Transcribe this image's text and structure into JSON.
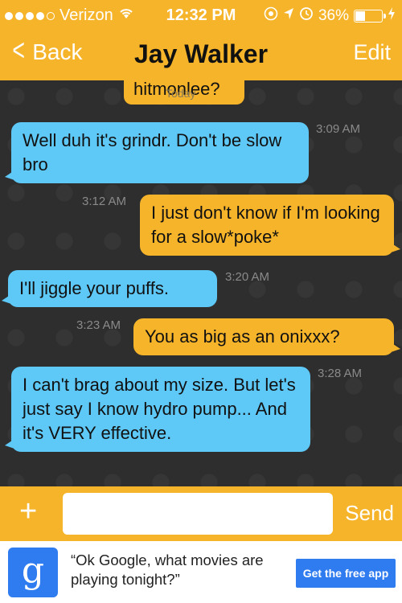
{
  "status_bar": {
    "carrier": "Verizon",
    "time": "12:32 PM",
    "battery": "36%",
    "battery_level": 0.36,
    "icons": [
      "signal-dots",
      "wifi-icon",
      "location-icon",
      "alarm-icon",
      "battery-icon",
      "charging-icon"
    ]
  },
  "nav": {
    "back_label": "Back",
    "title": "Jay Walker",
    "edit_label": "Edit"
  },
  "chat": {
    "partial_message": "hitmonlee?",
    "day_label": "Today",
    "messages": [
      {
        "side": "received",
        "text": "Well duh it's grindr. Don't be slow bro",
        "time": "3:09 AM"
      },
      {
        "side": "sent",
        "text": "I just don't know if I'm looking for a slow*poke*",
        "time": "3:12 AM"
      },
      {
        "side": "received",
        "text": "I'll jiggle your puffs.",
        "time": "3:20 AM"
      },
      {
        "side": "sent",
        "text": "You as big as an onixxx?",
        "time": "3:23 AM"
      },
      {
        "side": "received",
        "text": "I can't brag about my size. But let's just say I know hydro pump... And it's VERY effective.",
        "time": "3:28 AM"
      }
    ]
  },
  "input_bar": {
    "plus_label": "+",
    "placeholder": "",
    "send_label": "Send"
  },
  "ad": {
    "logo_letter": "g",
    "text": "“Ok Google, what movies are playing tonight?”",
    "cta": "Get the free app"
  },
  "colors": {
    "accent": "#f6b42a",
    "received_bubble": "#5ec8f7",
    "background": "#2e2e2e",
    "ad_blue": "#2f7bf0"
  }
}
